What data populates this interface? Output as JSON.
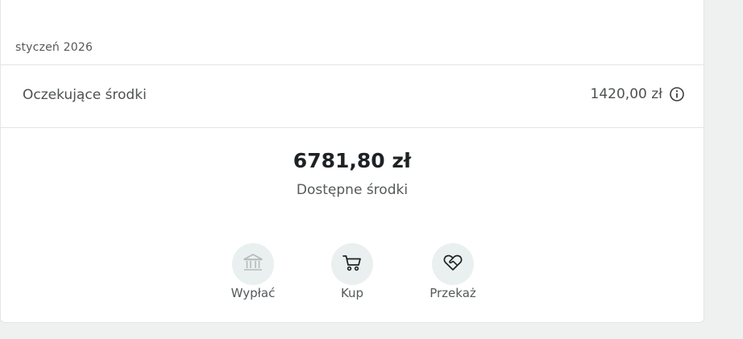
{
  "history": {
    "month": "styczeń 2026"
  },
  "pending": {
    "label": "Oczekujące środki",
    "amount": "1420,00 zł"
  },
  "balance": {
    "amount": "6781,80 zł",
    "label": "Dostępne środki"
  },
  "actions": [
    {
      "label": "Wypłać",
      "icon": "bank-icon",
      "enabled": false
    },
    {
      "label": "Kup",
      "icon": "cart-icon",
      "enabled": true
    },
    {
      "label": "Przekaż",
      "icon": "heart-hands-icon",
      "enabled": true
    }
  ],
  "colors": {
    "page_background": "#eef1f0",
    "card_background": "#ffffff",
    "action_circle": "#eaf0ef",
    "primary_text": "#1e2224",
    "muted_text": "#55595b"
  }
}
